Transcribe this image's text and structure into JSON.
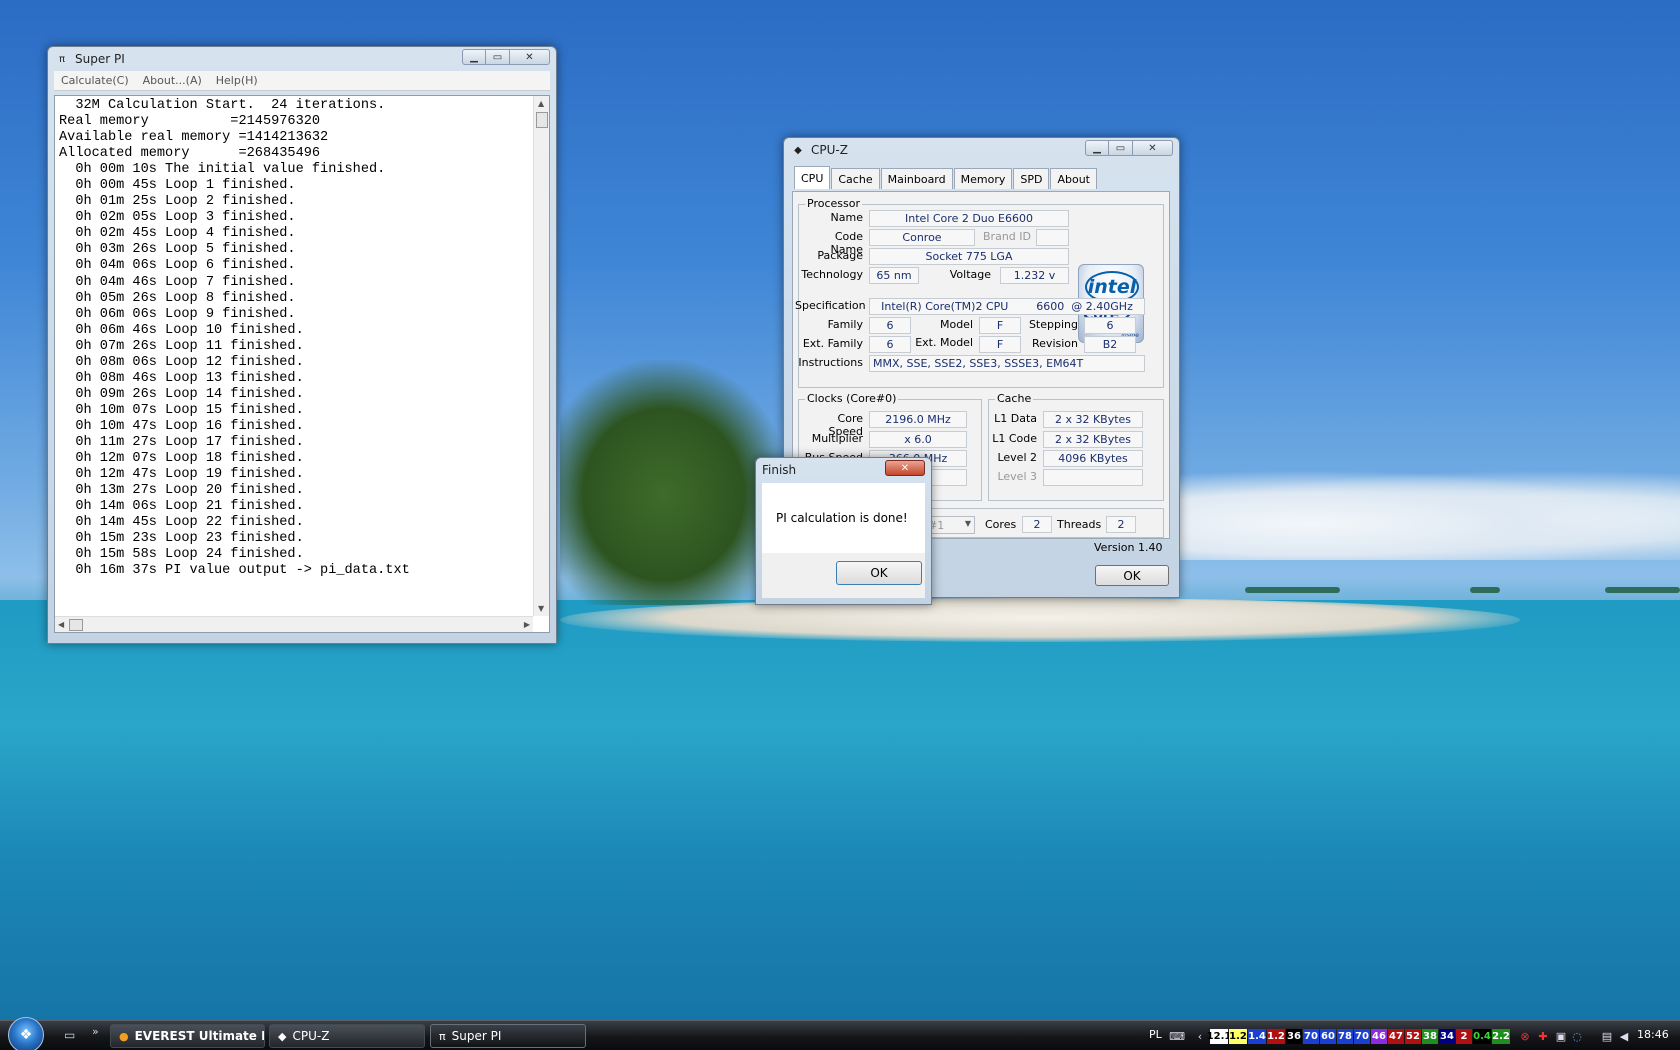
{
  "superpi": {
    "title": "Super PI",
    "icon": "pi-icon",
    "menu": [
      "Calculate(C)",
      "About...(A)",
      "Help(H)"
    ],
    "lines": [
      "  32M Calculation Start.  24 iterations.",
      "Real memory          =2145976320",
      "Available real memory =1414213632",
      "Allocated memory      =268435496",
      "  0h 00m 10s The initial value finished.",
      "  0h 00m 45s Loop 1 finished.",
      "  0h 01m 25s Loop 2 finished.",
      "  0h 02m 05s Loop 3 finished.",
      "  0h 02m 45s Loop 4 finished.",
      "  0h 03m 26s Loop 5 finished.",
      "  0h 04m 06s Loop 6 finished.",
      "  0h 04m 46s Loop 7 finished.",
      "  0h 05m 26s Loop 8 finished.",
      "  0h 06m 06s Loop 9 finished.",
      "  0h 06m 46s Loop 10 finished.",
      "  0h 07m 26s Loop 11 finished.",
      "  0h 08m 06s Loop 12 finished.",
      "  0h 08m 46s Loop 13 finished.",
      "  0h 09m 26s Loop 14 finished.",
      "  0h 10m 07s Loop 15 finished.",
      "  0h 10m 47s Loop 16 finished.",
      "  0h 11m 27s Loop 17 finished.",
      "  0h 12m 07s Loop 18 finished.",
      "  0h 12m 47s Loop 19 finished.",
      "  0h 13m 27s Loop 20 finished.",
      "  0h 14m 06s Loop 21 finished.",
      "  0h 14m 45s Loop 22 finished.",
      "  0h 15m 23s Loop 23 finished.",
      "  0h 15m 58s Loop 24 finished.",
      "  0h 16m 37s PI value output -> pi_data.txt"
    ]
  },
  "cpuz": {
    "title": "CPU-Z",
    "tabs": [
      "CPU",
      "Cache",
      "Mainboard",
      "Memory",
      "SPD",
      "About"
    ],
    "active_tab": "CPU",
    "processor": {
      "group_label": "Processor",
      "name_label": "Name",
      "name": "Intel Core 2 Duo E6600",
      "codename_label": "Code Name",
      "codename": "Conroe",
      "brandid_label": "Brand ID",
      "brandid": "",
      "package_label": "Package",
      "package": "Socket 775 LGA",
      "technology_label": "Technology",
      "technology": "65 nm",
      "voltage_label": "Voltage",
      "voltage": "1.232 v",
      "spec_label": "Specification",
      "spec": "Intel(R) Core(TM)2 CPU        6600  @ 2.40GHz",
      "family_label": "Family",
      "family": "6",
      "model_label": "Model",
      "model": "F",
      "stepping_label": "Stepping",
      "stepping": "6",
      "extfamily_label": "Ext. Family",
      "extfamily": "6",
      "extmodel_label": "Ext. Model",
      "extmodel": "F",
      "revision_label": "Revision",
      "revision": "B2",
      "instructions_label": "Instructions",
      "instructions": "MMX, SSE, SSE2, SSE3, SSSE3, EM64T"
    },
    "logo": {
      "brand": "intel",
      "line1": "Core 2",
      "line2": "Duo",
      "line3": "inside"
    },
    "clocks": {
      "group_label": "Clocks (Core#0)",
      "core_speed_label": "Core Speed",
      "core_speed": "2196.0 MHz",
      "multiplier_label": "Multiplier",
      "multiplier": "x 6.0",
      "bus_speed_label": "Bus Speed",
      "bus_speed": "366.0 MHz",
      "rated_fsb_value": "MHz"
    },
    "cache": {
      "group_label": "Cache",
      "l1data_label": "L1 Data",
      "l1data": "2 x 32 KBytes",
      "l1code_label": "L1 Code",
      "l1code": "2 x 32 KBytes",
      "level2_label": "Level 2",
      "level2": "4096 KBytes",
      "level3_label": "Level 3",
      "level3": ""
    },
    "selection_value": "#1",
    "cores_label": "Cores",
    "cores": "2",
    "threads_label": "Threads",
    "threads": "2",
    "version": "Version 1.40",
    "ok_label": "OK"
  },
  "finish_dialog": {
    "title": "Finish",
    "message": "PI calculation is done!",
    "ok_label": "OK"
  },
  "taskbar": {
    "tasks": [
      {
        "label": "EVEREST Ultimate E...",
        "icon": "everest-icon"
      },
      {
        "label": "CPU-Z",
        "icon": "cpuz-icon"
      },
      {
        "label": "Super PI",
        "icon": "pi-icon"
      }
    ],
    "language": "PL",
    "indicators": [
      {
        "text": "12.1",
        "bg": "#ffffff",
        "fg": "#000000"
      },
      {
        "text": "1.2",
        "bg": "#ffff66",
        "fg": "#000000"
      },
      {
        "text": "1.4",
        "bg": "#1a3fd1",
        "fg": "#ffffff"
      },
      {
        "text": "1.2",
        "bg": "#b01010",
        "fg": "#ffffff"
      },
      {
        "text": "36",
        "bg": "#000000",
        "fg": "#ffffff"
      },
      {
        "text": "70",
        "bg": "#1a3fd1",
        "fg": "#ffffff"
      },
      {
        "text": "60",
        "bg": "#1a3fd1",
        "fg": "#ffffff"
      },
      {
        "text": "78",
        "bg": "#1a3fd1",
        "fg": "#ffffff"
      },
      {
        "text": "70",
        "bg": "#1a3fd1",
        "fg": "#ffffff"
      },
      {
        "text": "46",
        "bg": "#8a2be2",
        "fg": "#ffffff"
      },
      {
        "text": "47",
        "bg": "#b01010",
        "fg": "#ffffff"
      },
      {
        "text": "52",
        "bg": "#b01010",
        "fg": "#ffffff"
      },
      {
        "text": "38",
        "bg": "#1e8f1e",
        "fg": "#ffffff"
      },
      {
        "text": "34",
        "bg": "#000080",
        "fg": "#ffffff"
      },
      {
        "text": "2",
        "bg": "#b01010",
        "fg": "#ffffff"
      },
      {
        "text": "0.4",
        "bg": "#000000",
        "fg": "#33dd33"
      },
      {
        "text": "2.2",
        "bg": "#1e8f1e",
        "fg": "#ffffff"
      }
    ],
    "clock": "18:46"
  }
}
